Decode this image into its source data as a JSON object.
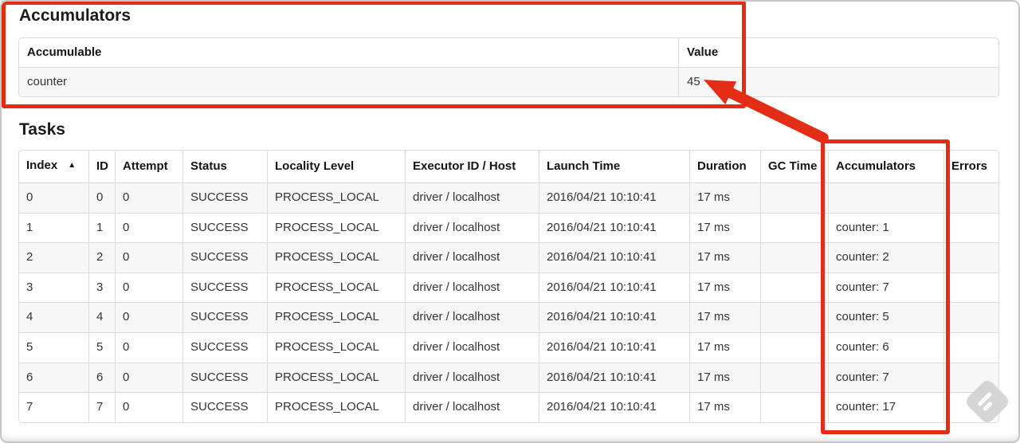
{
  "accumulators_section": {
    "heading": "Accumulators",
    "table": {
      "columns": [
        "Accumulable",
        "Value"
      ],
      "rows": [
        [
          "counter",
          "45"
        ]
      ]
    }
  },
  "tasks_section": {
    "heading": "Tasks",
    "table": {
      "columns": [
        "Index",
        "ID",
        "Attempt",
        "Status",
        "Locality Level",
        "Executor ID / Host",
        "Launch Time",
        "Duration",
        "GC Time",
        "Accumulators",
        "Errors"
      ],
      "sort": {
        "column": "Index",
        "indicator": "▲",
        "direction": "ascending"
      },
      "rows": [
        [
          "0",
          "0",
          "0",
          "SUCCESS",
          "PROCESS_LOCAL",
          "driver / localhost",
          "2016/04/21 10:10:41",
          "17 ms",
          "",
          "",
          ""
        ],
        [
          "1",
          "1",
          "0",
          "SUCCESS",
          "PROCESS_LOCAL",
          "driver / localhost",
          "2016/04/21 10:10:41",
          "17 ms",
          "",
          "counter: 1",
          ""
        ],
        [
          "2",
          "2",
          "0",
          "SUCCESS",
          "PROCESS_LOCAL",
          "driver / localhost",
          "2016/04/21 10:10:41",
          "17 ms",
          "",
          "counter: 2",
          ""
        ],
        [
          "3",
          "3",
          "0",
          "SUCCESS",
          "PROCESS_LOCAL",
          "driver / localhost",
          "2016/04/21 10:10:41",
          "17 ms",
          "",
          "counter: 7",
          ""
        ],
        [
          "4",
          "4",
          "0",
          "SUCCESS",
          "PROCESS_LOCAL",
          "driver / localhost",
          "2016/04/21 10:10:41",
          "17 ms",
          "",
          "counter: 5",
          ""
        ],
        [
          "5",
          "5",
          "0",
          "SUCCESS",
          "PROCESS_LOCAL",
          "driver / localhost",
          "2016/04/21 10:10:41",
          "17 ms",
          "",
          "counter: 6",
          ""
        ],
        [
          "6",
          "6",
          "0",
          "SUCCESS",
          "PROCESS_LOCAL",
          "driver / localhost",
          "2016/04/21 10:10:41",
          "17 ms",
          "",
          "counter: 7",
          ""
        ],
        [
          "7",
          "7",
          "0",
          "SUCCESS",
          "PROCESS_LOCAL",
          "driver / localhost",
          "2016/04/21 10:10:41",
          "17 ms",
          "",
          "counter: 17",
          ""
        ]
      ]
    }
  },
  "annotations": {
    "color": "#e42d16",
    "highlighted_regions": [
      "Accumulators section",
      "Accumulators column of Tasks table"
    ],
    "arrow_points_to_value": "45"
  }
}
